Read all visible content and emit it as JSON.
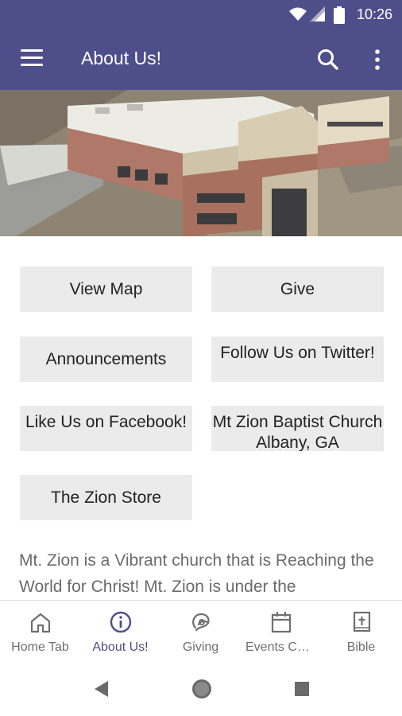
{
  "status_bar": {
    "time": "10:26"
  },
  "app_bar": {
    "title": "About Us!"
  },
  "buttons": {
    "view_map": "View Map",
    "give": "Give",
    "announcements": "Announcements",
    "follow_twitter": "Follow Us on Twitter!",
    "like_facebook": "Like Us on Facebook!",
    "mt_zion": "Mt Zion Baptist Church Albany, GA",
    "zion_store": "The Zion Store"
  },
  "description": "Mt. Zion is a Vibrant church that is Reaching the World for Christ!   Mt. Zion is under the",
  "bottom_nav": {
    "items": [
      {
        "label": "Home Tab",
        "icon": "home-icon"
      },
      {
        "label": "About Us!",
        "icon": "info-icon"
      },
      {
        "label": "Giving",
        "icon": "giving-icon"
      },
      {
        "label": "Events Calendar",
        "icon": "calendar-icon"
      },
      {
        "label": "Bible",
        "icon": "bible-icon"
      }
    ],
    "active_index": 1
  },
  "colors": {
    "primary": "#4e4e8a",
    "button_bg": "#ebebeb"
  }
}
